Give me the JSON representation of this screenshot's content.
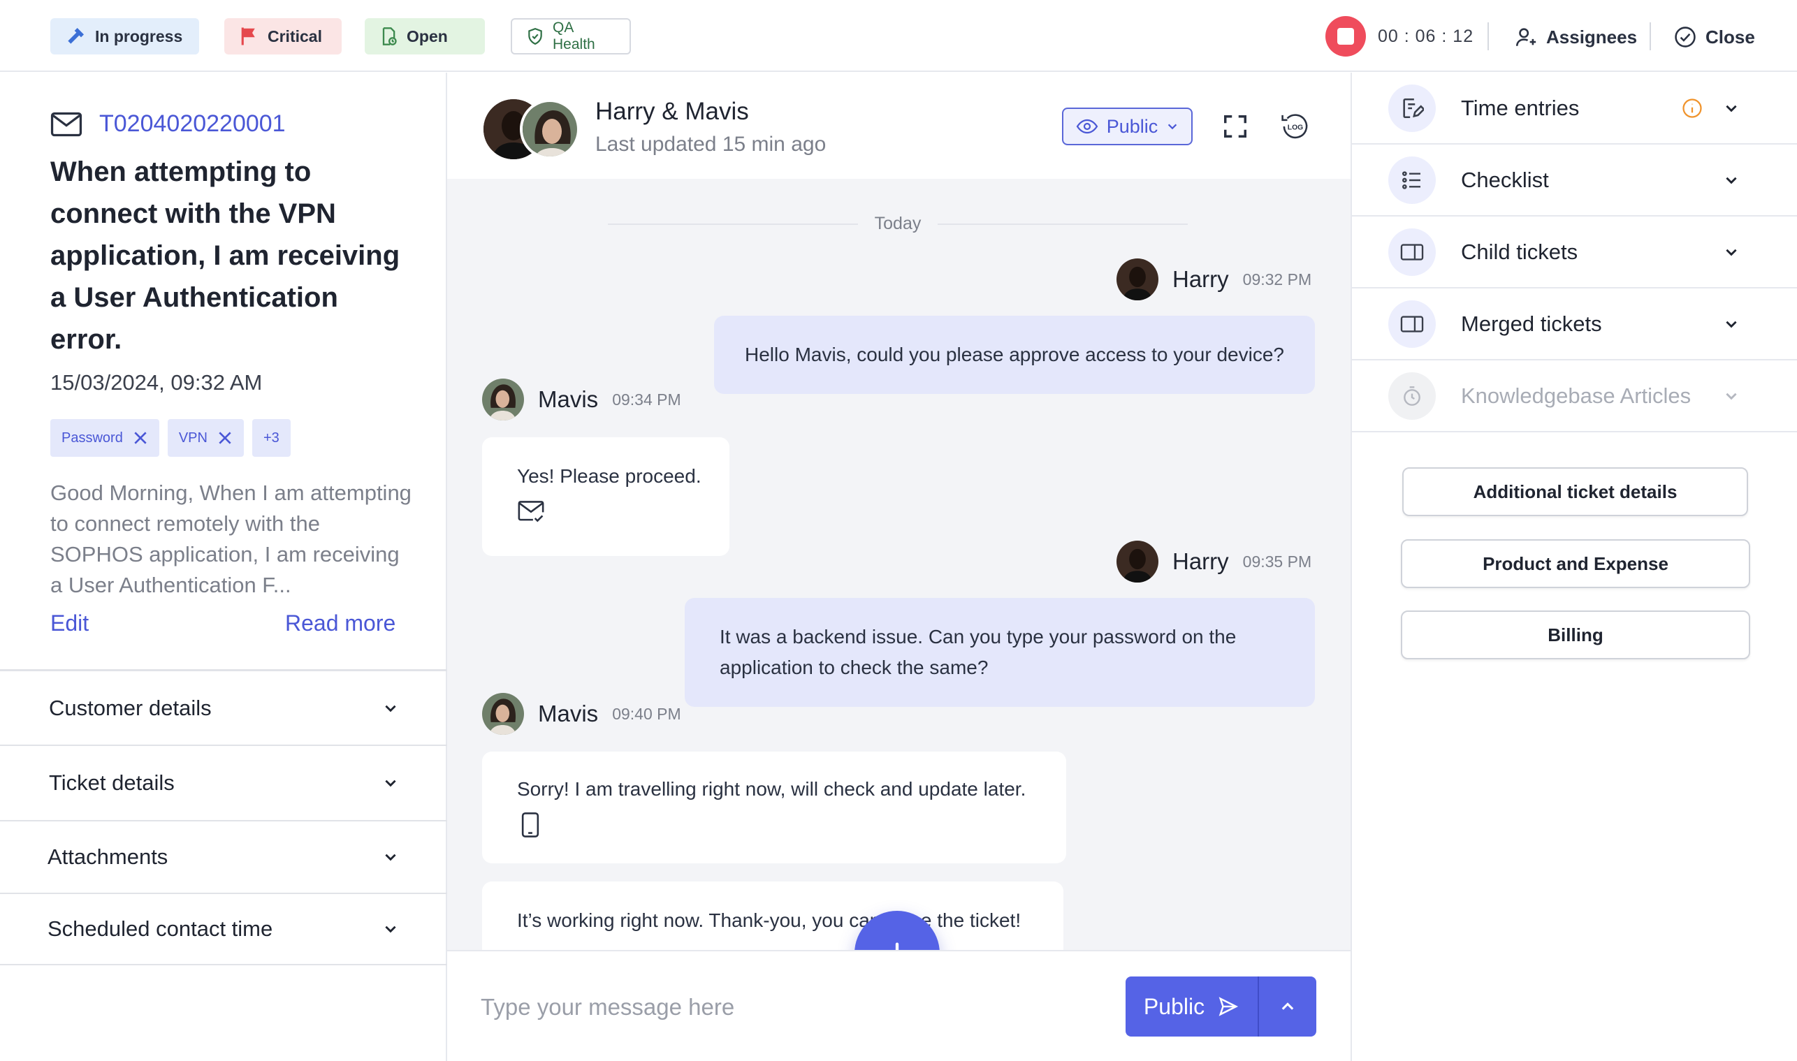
{
  "topbar": {
    "status_chips": {
      "progress": "In progress",
      "priority": "Critical",
      "state": "Open",
      "qa": "QA Health"
    },
    "timer": "00 : 06 : 12",
    "assignees_label": "Assignees",
    "close_label": "Close"
  },
  "ticket": {
    "id": "T0204020220001",
    "title": "When attempting to connect with the VPN application, I am receiving a User Authentication error.",
    "date": "15/03/2024, 09:32 AM",
    "tags": [
      "Password",
      "VPN"
    ],
    "more_tags": "+3",
    "description": "Good Morning,  When I am attempting to connect remotely with the SOPHOS application, I am receiving a User Authentication F...",
    "edit_label": "Edit",
    "read_more_label": "Read more"
  },
  "left_sections": [
    "Customer details",
    "Ticket details",
    "Attachments",
    "Scheduled contact time"
  ],
  "chat": {
    "title": "Harry & Mavis",
    "updated": "Last updated 15 min ago",
    "visibility": "Public",
    "day_divider": "Today",
    "messages": [
      {
        "sender": "Harry",
        "time": "09:32 PM",
        "text": "Hello Mavis, could you please approve access to your device?"
      },
      {
        "sender": "Mavis",
        "time": "09:34 PM",
        "text": "Yes! Please proceed."
      },
      {
        "sender": "Harry",
        "time": "09:35 PM",
        "text": "It was a backend issue. Can you type your password on the application to check the same?"
      },
      {
        "sender": "Mavis",
        "time": "09:40 PM",
        "text": "Sorry! I am travelling right now, will check and update later."
      },
      {
        "sender": "Mavis",
        "time": "",
        "text": "It’s working right now. Thank-you, you can close the ticket!"
      }
    ],
    "composer_placeholder": "Type your message here",
    "send_label": "Public"
  },
  "right_panel": {
    "items": [
      {
        "label": "Time entries",
        "icon": "time-entry-icon"
      },
      {
        "label": "Checklist",
        "icon": "checklist-icon"
      },
      {
        "label": "Child tickets",
        "icon": "ticket-icon"
      },
      {
        "label": "Merged tickets",
        "icon": "ticket-icon"
      },
      {
        "label": "Knowledgebase Articles",
        "icon": "stopwatch-icon",
        "disabled": true
      }
    ],
    "buttons": [
      "Additional ticket details",
      "Product and Expense",
      "Billing"
    ]
  },
  "colors": {
    "accent": "#5563e6",
    "link": "#4a57d6",
    "record": "#ef4c5c",
    "outgoing_bubble": "#e4e7fb",
    "chat_background": "#f3f4f7"
  }
}
